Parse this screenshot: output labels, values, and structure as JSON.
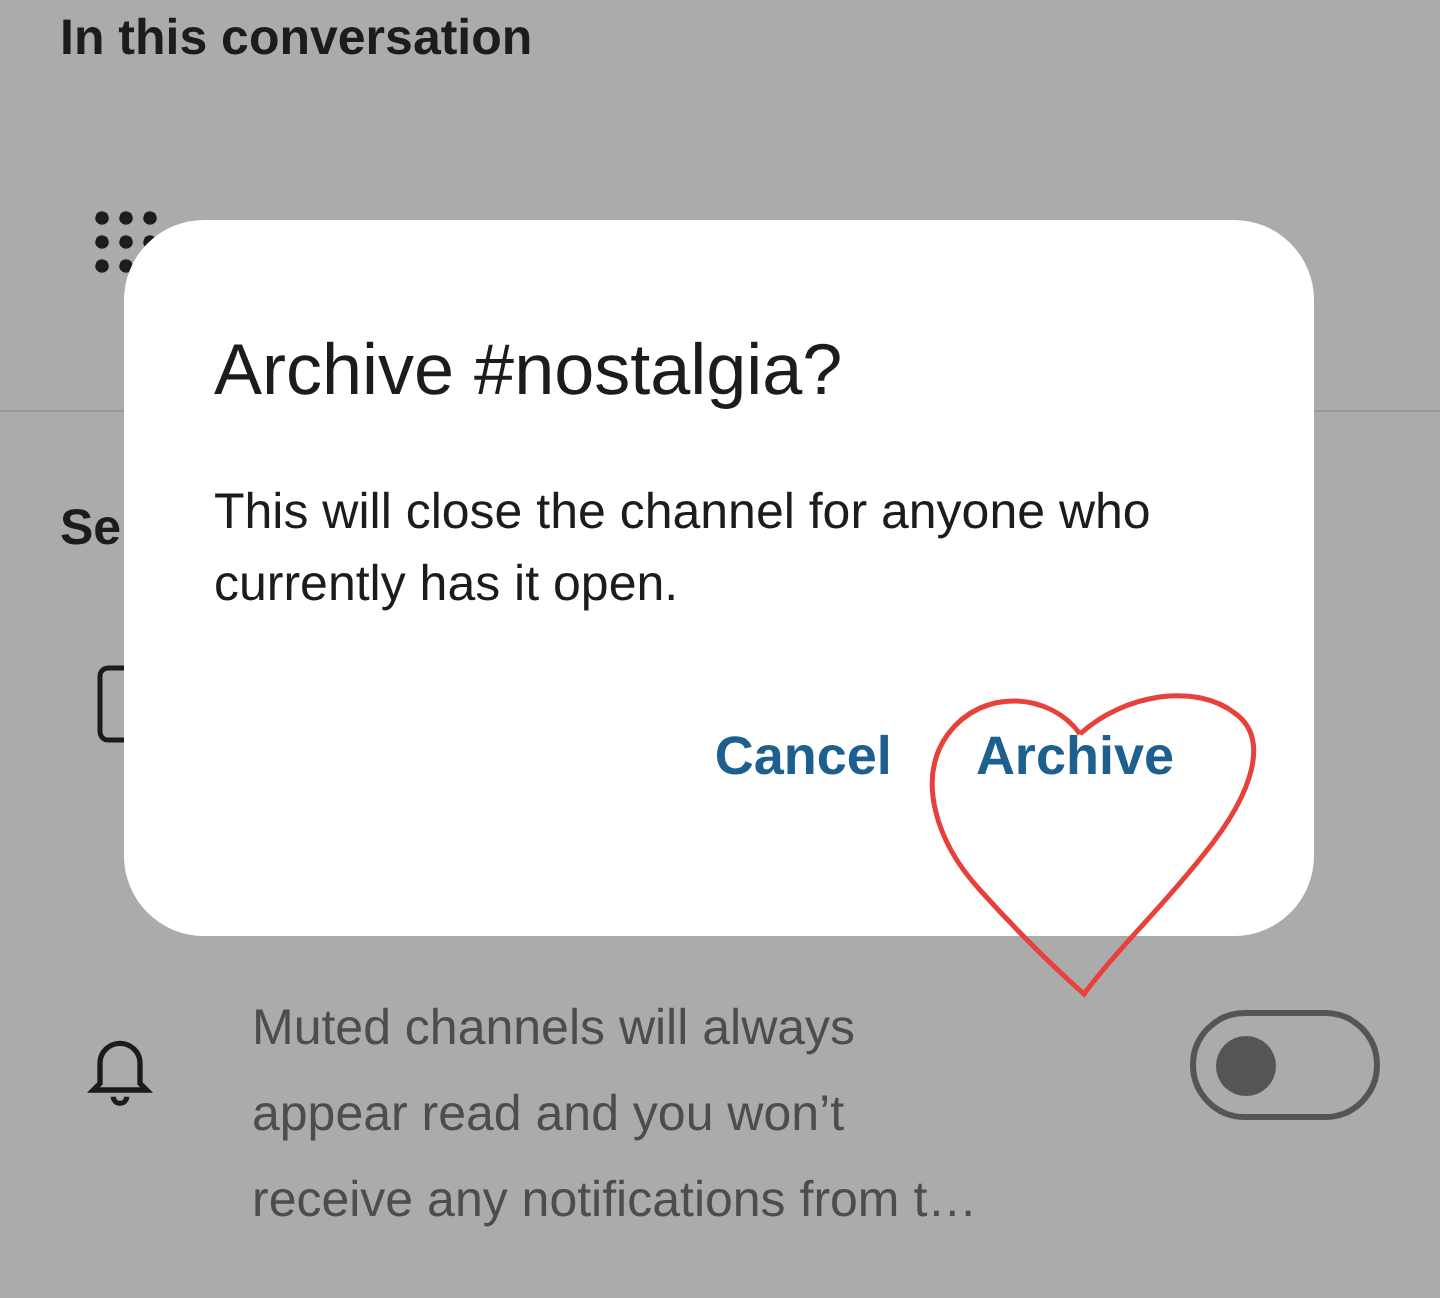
{
  "header": {
    "title": "In this conversation"
  },
  "section": {
    "title": "Se"
  },
  "mute_item": {
    "description_lines": [
      "Muted channels will always",
      "appear read and you won’t",
      "receive any notifications from t…"
    ],
    "on": false
  },
  "dialog": {
    "title": "Archive #nostalgia?",
    "message": "This will close the channel for anyone who currently has it open.",
    "buttons": [
      {
        "label": "Cancel"
      },
      {
        "label": "Archive"
      }
    ]
  }
}
